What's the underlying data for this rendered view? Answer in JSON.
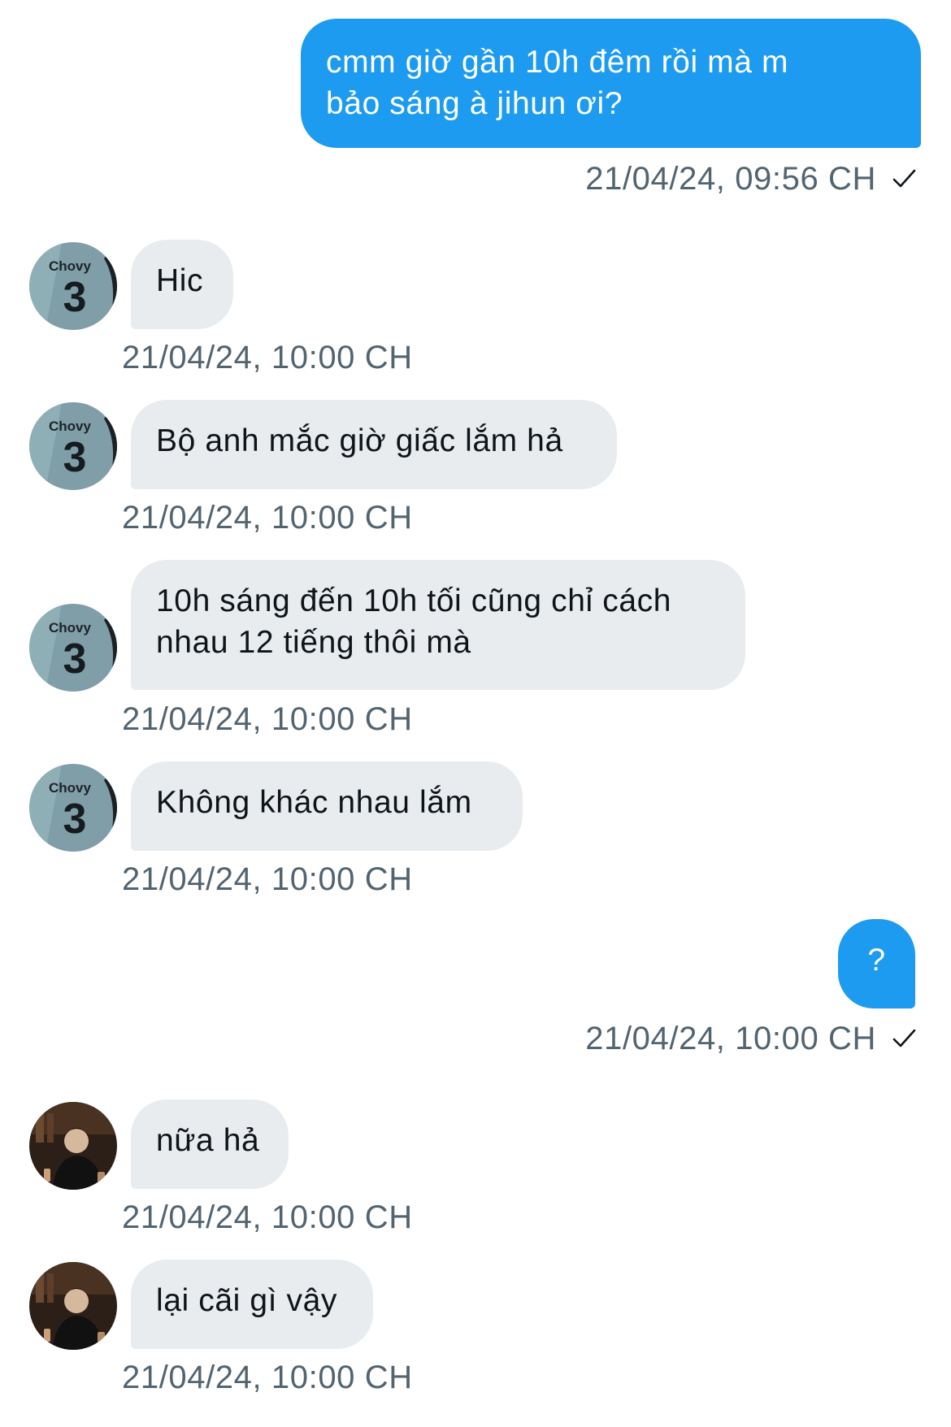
{
  "colors": {
    "outgoing_bubble": "#1d9bf0",
    "incoming_bubble": "#e8ecef",
    "timestamp": "#536471"
  },
  "messages": [
    {
      "direction": "outgoing",
      "text": "cmm giờ gần 10h đêm rồi mà m\nbảo sáng à jihun ơi?",
      "timestamp": "21/04/24, 09:56 CH",
      "status_icon": "checkmark-icon"
    },
    {
      "direction": "incoming",
      "avatar": "avatar-chovy-jersey",
      "text": "Hic",
      "timestamp": "21/04/24, 10:00 CH"
    },
    {
      "direction": "incoming",
      "avatar": "avatar-chovy-jersey",
      "text": "Bộ anh mắc giờ giấc lắm hả",
      "timestamp": "21/04/24, 10:00 CH"
    },
    {
      "direction": "incoming",
      "avatar": "avatar-chovy-jersey",
      "text": "10h sáng đến 10h tối cũng chỉ cách\nnhau 12 tiếng thôi mà",
      "timestamp": "21/04/24, 10:00 CH"
    },
    {
      "direction": "incoming",
      "avatar": "avatar-chovy-jersey",
      "text": "Không khác nhau lắm",
      "timestamp": "21/04/24, 10:00 CH"
    },
    {
      "direction": "outgoing",
      "text": "?",
      "timestamp": "21/04/24, 10:00 CH",
      "status_icon": "checkmark-icon"
    },
    {
      "direction": "incoming",
      "avatar": "avatar-person-photo",
      "text": "nữa hả",
      "timestamp": "21/04/24, 10:00 CH"
    },
    {
      "direction": "incoming",
      "avatar": "avatar-person-photo",
      "text": "lại cãi gì vậy",
      "timestamp": "21/04/24, 10:00 CH"
    }
  ],
  "avatars": {
    "jersey_text": "Chovy",
    "jersey_number": "3"
  }
}
